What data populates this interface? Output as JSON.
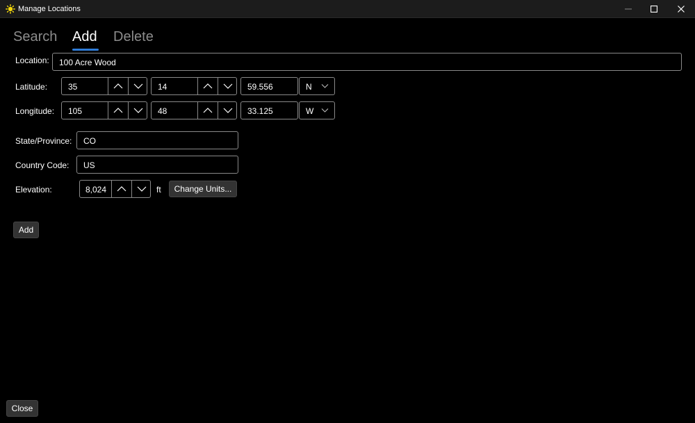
{
  "window": {
    "title": "Manage Locations",
    "icon": "sun-icon",
    "controls": [
      "minimize-icon",
      "maximize-icon",
      "close-icon"
    ]
  },
  "tabs": [
    {
      "label": "Search",
      "active": false
    },
    {
      "label": "Add",
      "active": true
    },
    {
      "label": "Delete",
      "active": false
    }
  ],
  "form": {
    "location": {
      "label": "Location:",
      "value": "100 Acre Wood"
    },
    "latitude": {
      "label": "Latitude:",
      "degrees": "35",
      "minutes": "14",
      "seconds": "59.556",
      "hemisphere": "N"
    },
    "longitude": {
      "label": "Longitude:",
      "degrees": "105",
      "minutes": "48",
      "seconds": "33.125",
      "hemisphere": "W"
    },
    "state": {
      "label": "State/Province:",
      "value": "CO"
    },
    "country": {
      "label": "Country Code:",
      "value": "US"
    },
    "elevation": {
      "label": "Elevation:",
      "value": "8,024",
      "unit": "ft",
      "change_units_label": "Change Units..."
    },
    "add_label": "Add"
  },
  "footer": {
    "close_label": "Close"
  },
  "colors": {
    "accent": "#2f7cd8",
    "background": "#000000",
    "titlebar": "#1c1c1c",
    "button": "#333333",
    "border": "#8a8a8a"
  }
}
